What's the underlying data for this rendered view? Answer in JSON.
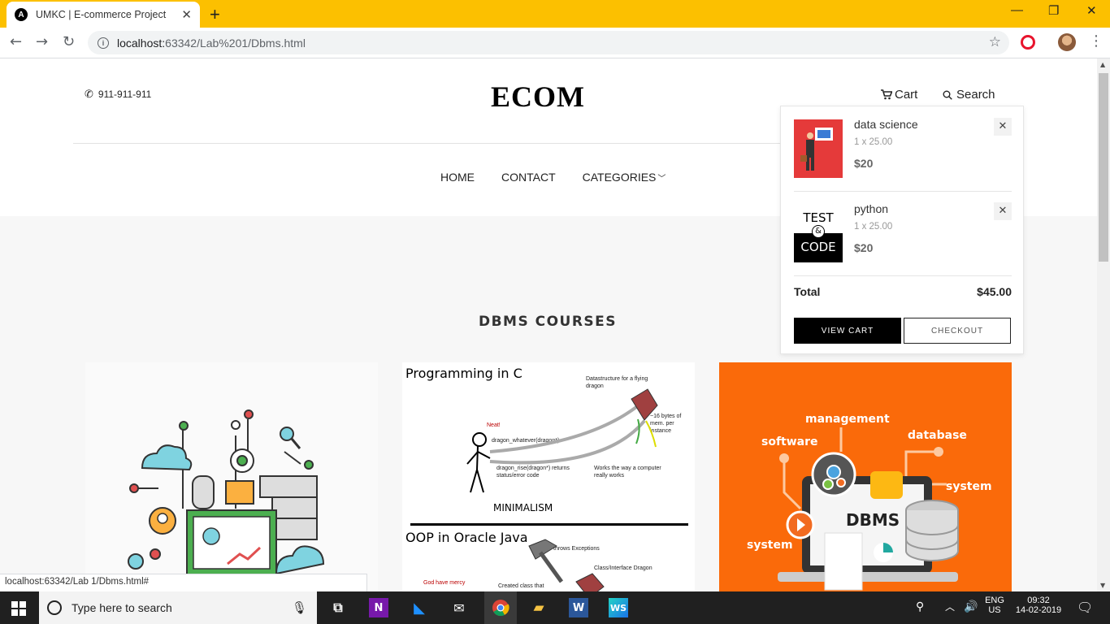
{
  "browser": {
    "tab_title": "UMKC | E-commerce Project",
    "tab_favicon": "A",
    "new_tab": "+",
    "url_host": "localhost:",
    "url_path": "63342/Lab%201/Dbms.html",
    "status_url": "localhost:63342/Lab 1/Dbms.html#"
  },
  "header": {
    "phone": "911-911-911",
    "logo": "ECOM",
    "cart_label": "Cart",
    "search_label": "Search"
  },
  "nav": {
    "items": [
      {
        "label": "HOME"
      },
      {
        "label": "CONTACT"
      },
      {
        "label": "CATEGORIES"
      }
    ]
  },
  "section": {
    "title": "DBMS COURSES"
  },
  "cards": {
    "card2": {
      "heading1": "Programming in C",
      "note_top": "Datastructure for a flying dragon",
      "note_neat": "Neat!",
      "note_whatever": "dragon_whatever(dragon*)",
      "note_rise": "dragon_rise(dragon*) returns status/error code",
      "note_bytes": "~16 bytes of mem. per instance",
      "note_works": "Works the way a computer really works",
      "minimalism": "MINIMALISM",
      "heading2": "OOP in Oracle Java",
      "note_throws": "throws Exceptions",
      "note_class": "Class/Interface Dragon",
      "note_created": "Created class that",
      "note_god": "God have mercy"
    },
    "card3": {
      "w_management": "management",
      "w_software": "software",
      "w_database": "database",
      "w_system_right": "system",
      "w_system_left": "system",
      "w_dbms": "DBMS"
    }
  },
  "cart_dropdown": {
    "items": [
      {
        "name": "data science",
        "qty": "1 x 25.00",
        "price": "$20"
      },
      {
        "name": "python",
        "qty": "1 x 25.00",
        "price": "$20",
        "thumb_top": "TEST",
        "thumb_mid": "&",
        "thumb_bottom": "CODE"
      }
    ],
    "total_label": "Total",
    "total_value": "$45.00",
    "view_cart": "VIEW CART",
    "checkout": "CHECKOUT"
  },
  "taskbar": {
    "search_placeholder": "Type here to search",
    "lang_top": "ENG",
    "lang_bottom": "US",
    "time": "09:32",
    "date": "14-02-2019"
  }
}
